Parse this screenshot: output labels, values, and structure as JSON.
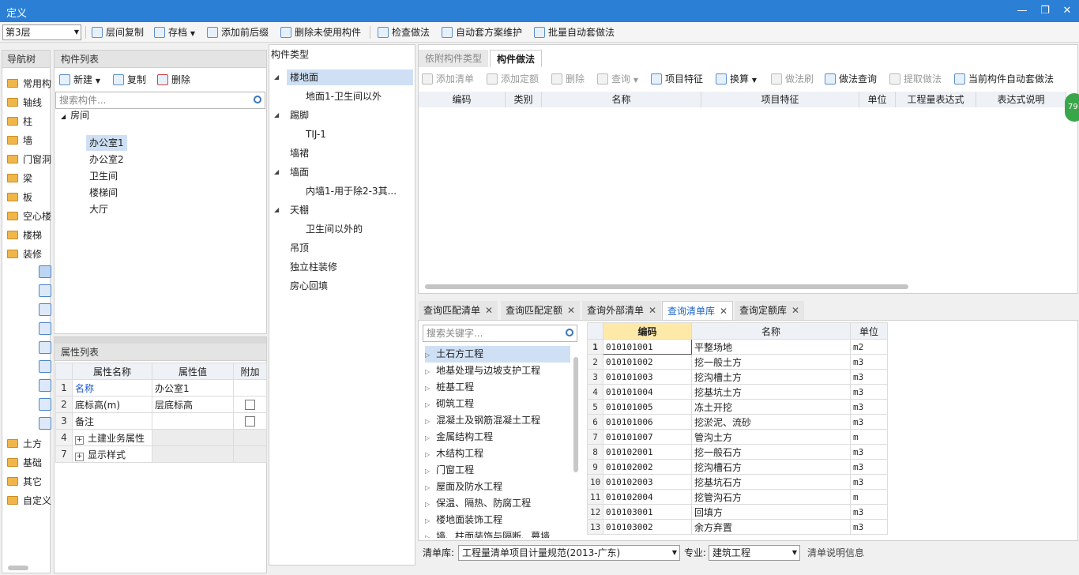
{
  "window": {
    "title": "定义",
    "min": "—",
    "restore": "❐",
    "close": "✕"
  },
  "toolbar": {
    "floor": "第3层",
    "items": [
      "层间复制",
      "存档",
      "添加前后缀",
      "删除未使用构件",
      "检查做法",
      "自动套方案维护",
      "批量自动套做法"
    ]
  },
  "nav": {
    "title": "导航树",
    "items": [
      "常用构",
      "轴线",
      "柱",
      "墙",
      "门窗洞",
      "梁",
      "板",
      "空心楼",
      "楼梯",
      "装修",
      "土方",
      "基础",
      "其它",
      "自定义"
    ],
    "sub_icons": [
      "home-icon",
      "floor-icon",
      "wall-face-icon",
      "stair-icon",
      "brick-icon",
      "ceiling-icon",
      "room-fill-icon",
      "column-icon",
      "roof-icon"
    ]
  },
  "component_list": {
    "title": "构件列表",
    "new": "新建",
    "copy": "复制",
    "delete": "删除",
    "search_placeholder": "搜索构件...",
    "group": "房间",
    "items": [
      "办公室1",
      "办公室2",
      "卫生间",
      "楼梯间",
      "大厅"
    ]
  },
  "properties": {
    "title": "属性列表",
    "headers": [
      "属性名称",
      "属性值",
      "附加"
    ],
    "rows": [
      {
        "n": "1",
        "name": "名称",
        "value": "办公室1"
      },
      {
        "n": "2",
        "name": "底标高(m)",
        "value": "层底标高"
      },
      {
        "n": "3",
        "name": "备注",
        "value": ""
      },
      {
        "n": "4",
        "name": "土建业务属性",
        "value": ""
      },
      {
        "n": "7",
        "name": "显示样式",
        "value": ""
      }
    ]
  },
  "types": {
    "title": "构件类型",
    "nodes": [
      {
        "label": "楼地面",
        "level": 0,
        "exp": true
      },
      {
        "label": "地面1-卫生间以外",
        "level": 1
      },
      {
        "label": "踢脚",
        "level": 0,
        "exp": true
      },
      {
        "label": "TIJ-1",
        "level": 1
      },
      {
        "label": "墙裙",
        "level": 0
      },
      {
        "label": "墙面",
        "level": 0,
        "exp": true
      },
      {
        "label": "内墙1-用于除2-3其...",
        "level": 1
      },
      {
        "label": "天棚",
        "level": 0,
        "exp": true
      },
      {
        "label": "卫生间以外的",
        "level": 1
      },
      {
        "label": "吊顶",
        "level": 0
      },
      {
        "label": "独立柱装修",
        "level": 0
      },
      {
        "label": "房心回填",
        "level": 0
      }
    ]
  },
  "method": {
    "tabs": [
      "依附构件类型",
      "构件做法"
    ],
    "tools": [
      "添加清单",
      "添加定额",
      "删除",
      "查询",
      "项目特征",
      "换算",
      "做法刷",
      "做法查询",
      "提取做法",
      "当前构件自动套做法"
    ],
    "headers": [
      "编码",
      "类别",
      "名称",
      "项目特征",
      "单位",
      "工程量表达式",
      "表达式说明"
    ],
    "badge": "79"
  },
  "query": {
    "tabs": [
      "查询匹配清单",
      "查询匹配定额",
      "查询外部清单",
      "查询清单库",
      "查询定额库"
    ],
    "search_placeholder": "搜索关键字...",
    "categories": [
      "土石方工程",
      "地基处理与边坡支护工程",
      "桩基工程",
      "砌筑工程",
      "混凝土及钢筋混凝土工程",
      "金属结构工程",
      "木结构工程",
      "门窗工程",
      "屋面及防水工程",
      "保温、隔热、防腐工程",
      "楼地面装饰工程",
      "墙、柱面装饰与隔断、幕墙..."
    ],
    "headers": [
      "编码",
      "名称",
      "单位"
    ],
    "rows": [
      [
        "1",
        "010101001",
        "平整场地",
        "m2"
      ],
      [
        "2",
        "010101002",
        "挖一般土方",
        "m3"
      ],
      [
        "3",
        "010101003",
        "挖沟槽土方",
        "m3"
      ],
      [
        "4",
        "010101004",
        "挖基坑土方",
        "m3"
      ],
      [
        "5",
        "010101005",
        "冻土开挖",
        "m3"
      ],
      [
        "6",
        "010101006",
        "挖淤泥、流砂",
        "m3"
      ],
      [
        "7",
        "010101007",
        "管沟土方",
        "m"
      ],
      [
        "8",
        "010102001",
        "挖一般石方",
        "m3"
      ],
      [
        "9",
        "010102002",
        "挖沟槽石方",
        "m3"
      ],
      [
        "10",
        "010102003",
        "挖基坑石方",
        "m3"
      ],
      [
        "11",
        "010102004",
        "挖管沟石方",
        "m"
      ],
      [
        "12",
        "010103001",
        "回填方",
        "m3"
      ],
      [
        "13",
        "010103002",
        "余方弃置",
        "m3"
      ]
    ],
    "bottom": {
      "lib_label": "清单库:",
      "lib_value": "工程量清单项目计量规范(2013-广东)",
      "major_label": "专业:",
      "major_value": "建筑工程",
      "info": "清单说明信息"
    }
  }
}
